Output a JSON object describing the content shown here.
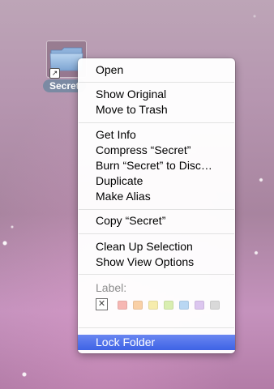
{
  "desktop": {
    "icon": {
      "name": "folder-icon",
      "label": "Secret",
      "alias_badge": "alias-arrow-icon"
    }
  },
  "context_menu": {
    "items": [
      {
        "label": "Open"
      },
      {
        "label": "Show Original"
      },
      {
        "label": "Move to Trash"
      },
      {
        "label": "Get Info"
      },
      {
        "label": "Compress “Secret”"
      },
      {
        "label": "Burn “Secret” to Disc…"
      },
      {
        "label": "Duplicate"
      },
      {
        "label": "Make Alias"
      },
      {
        "label": "Copy “Secret”"
      },
      {
        "label": "Clean Up Selection"
      },
      {
        "label": "Show View Options"
      },
      {
        "label": "Lock Folder",
        "selected": true
      }
    ],
    "label_section": {
      "heading": "Label:",
      "none_glyph": "✕",
      "colors": [
        "#f6b7b3",
        "#f9d0a6",
        "#f6ecac",
        "#d9eeb0",
        "#b9d7f3",
        "#dcc6ef",
        "#d9d9d9"
      ]
    },
    "selection_color": "#3e63e5"
  }
}
